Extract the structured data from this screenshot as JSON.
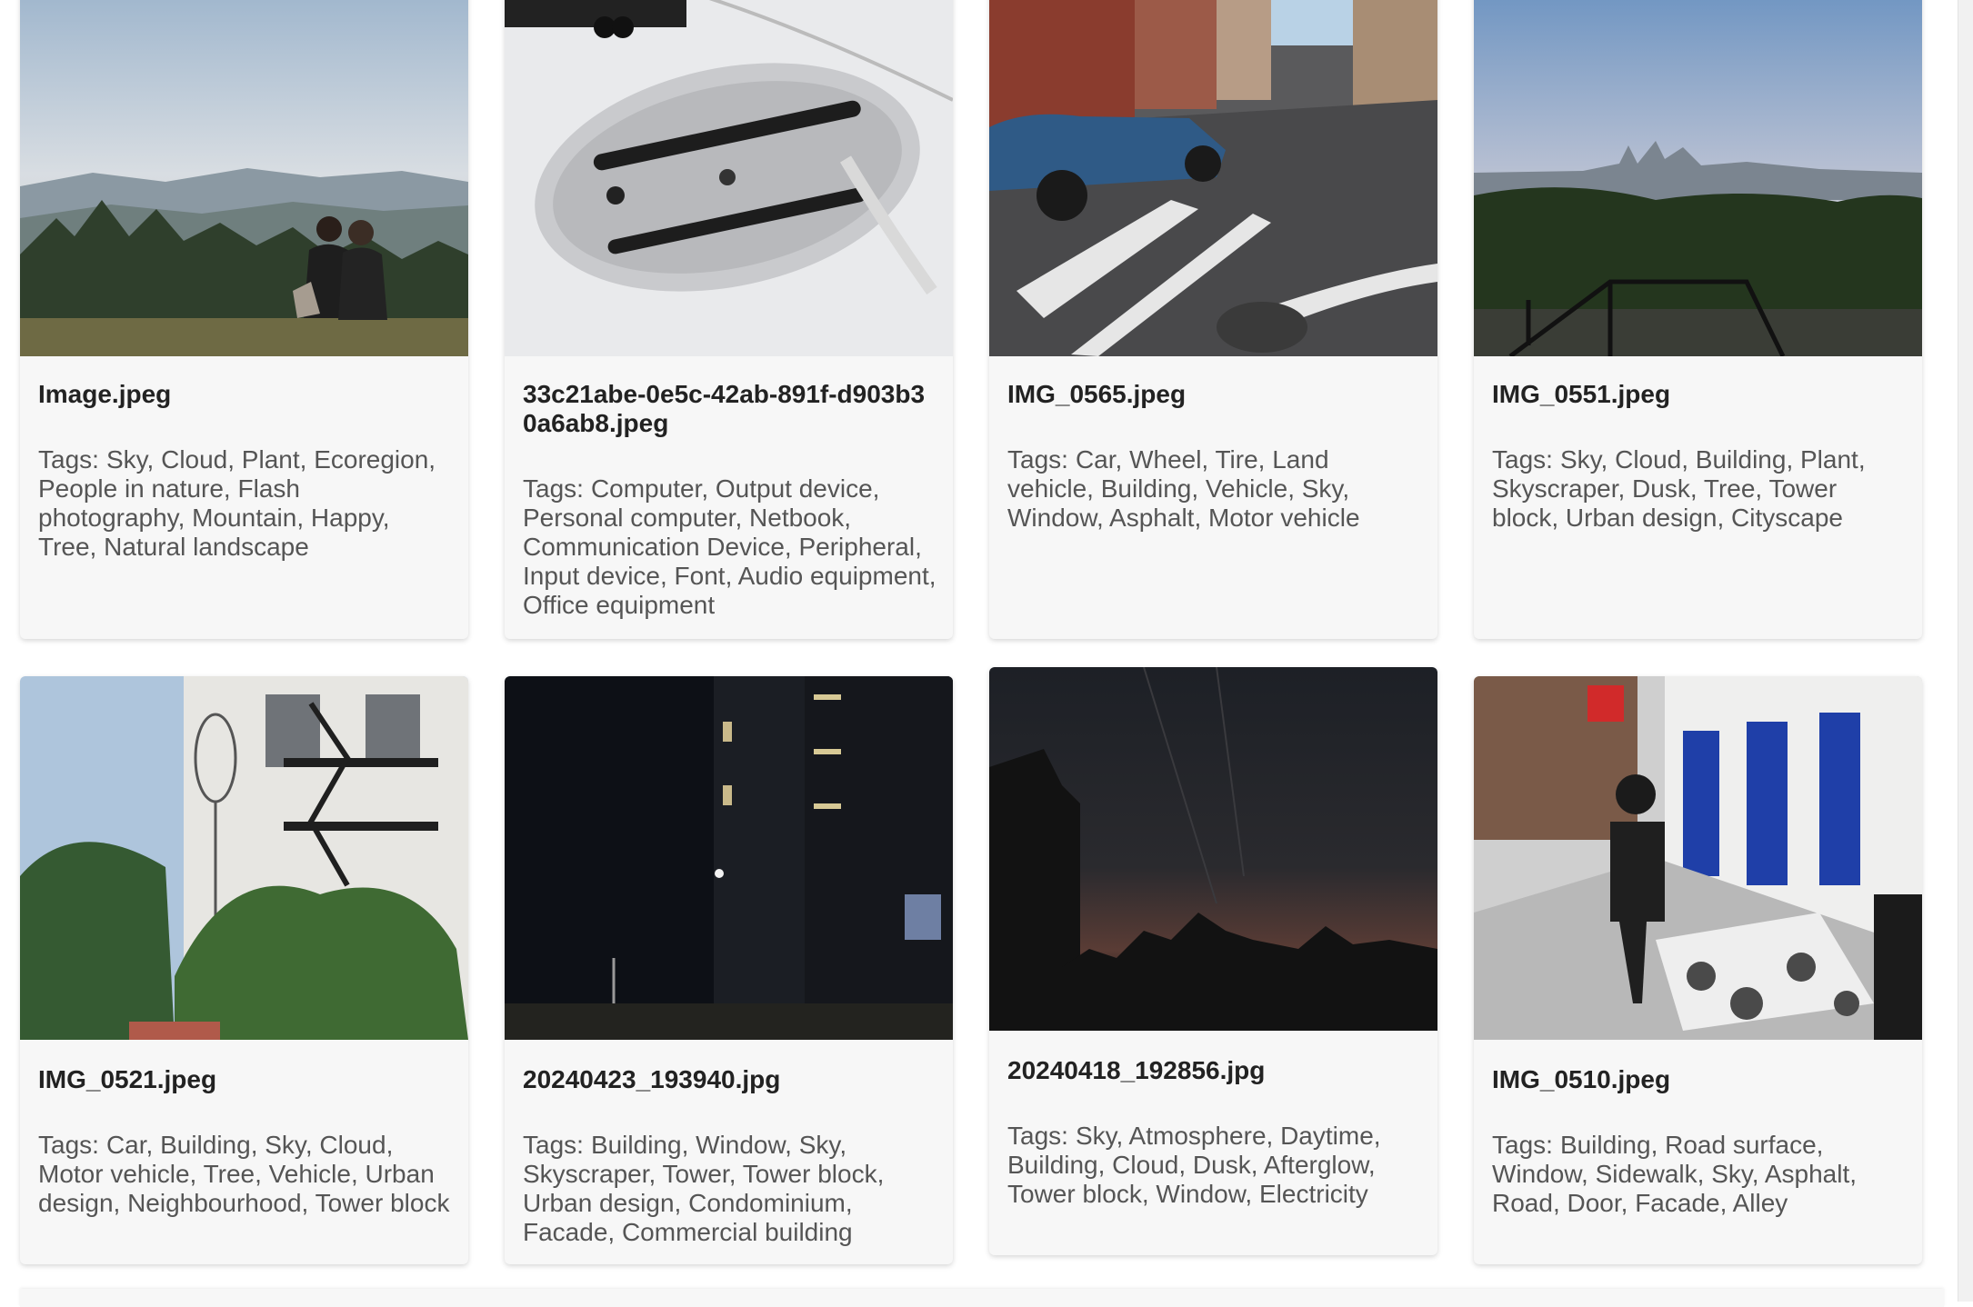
{
  "gallery": {
    "tag_prefix": "Tags:",
    "cards": [
      {
        "filename": "Image.jpeg",
        "tags": "Sky, Cloud, Plant, Ecoregion, People in nature, Flash photography, Mountain, Happy, Tree, Natural landscape"
      },
      {
        "filename": "33c21abe-0e5c-42ab-891f-d903b30a6ab8.jpeg",
        "tags": "Computer, Output device, Personal computer, Netbook, Communication Device, Peripheral, Input device, Font, Audio equipment, Office equipment"
      },
      {
        "filename": "IMG_0565.jpeg",
        "tags": "Car, Wheel, Tire, Land vehicle, Building, Vehicle, Sky, Window, Asphalt, Motor vehicle"
      },
      {
        "filename": "IMG_0551.jpeg",
        "tags": "Sky, Cloud, Building, Plant, Skyscraper, Dusk, Tree, Tower block, Urban design, Cityscape"
      },
      {
        "filename": "IMG_0521.jpeg",
        "tags": "Car, Building, Sky, Cloud, Motor vehicle, Tree, Vehicle, Urban design, Neighbourhood, Tower block"
      },
      {
        "filename": "20240423_193940.jpg",
        "tags": "Building, Window, Sky, Skyscraper, Tower, Tower block, Urban design, Condominium, Facade, Commercial building"
      },
      {
        "filename": "20240418_192856.jpg",
        "tags": "Sky, Atmosphere, Daytime, Building, Cloud, Dusk, Afterglow, Tower block, Window, Electricity"
      },
      {
        "filename": "IMG_0510.jpeg",
        "tags": "Building, Road surface, Window, Sidewalk, Sky, Asphalt, Road, Door, Facade, Alley"
      }
    ]
  }
}
